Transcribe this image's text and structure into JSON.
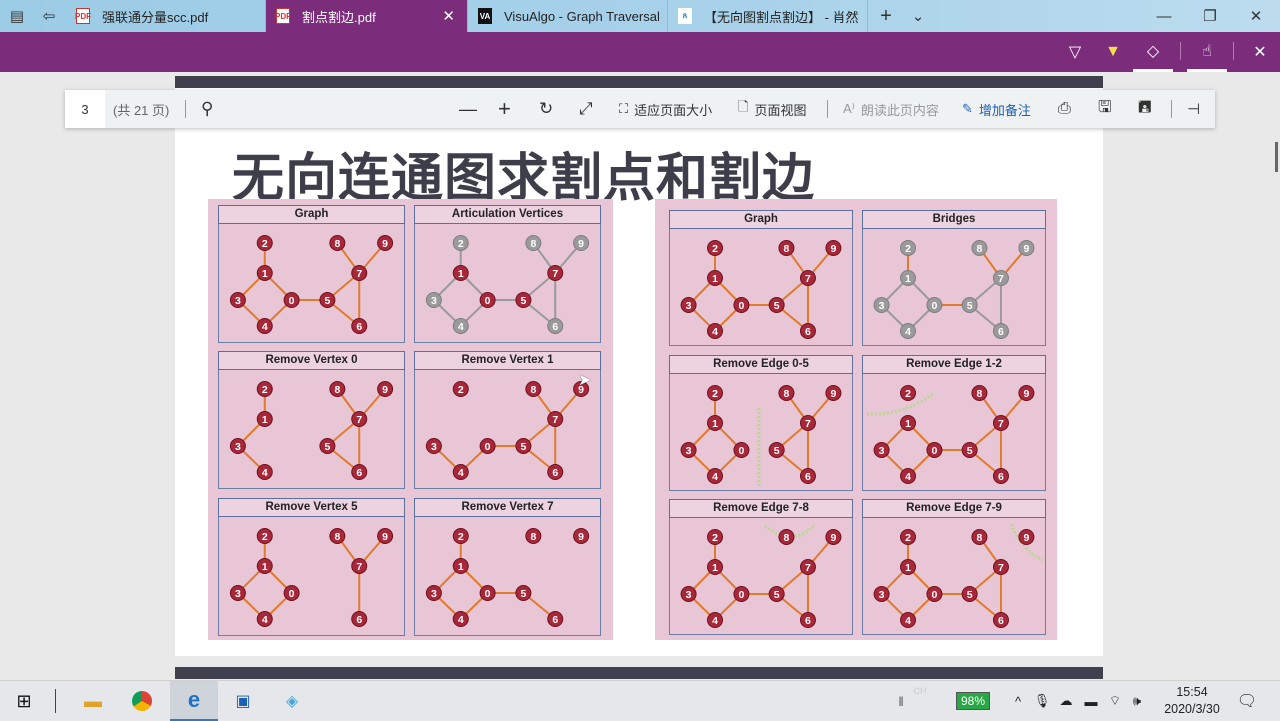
{
  "browser": {
    "tabs": [
      {
        "title": "强联通分量scc.pdf",
        "icon": "pdf-icon",
        "active": false
      },
      {
        "title": "割点割边.pdf",
        "icon": "pdf-icon",
        "active": true
      },
      {
        "title": "VisuAlgo - Graph Traversal (",
        "icon": "visualgo-icon",
        "active": false
      },
      {
        "title": "【无向图割点割边】 - 肖然",
        "icon": "site-icon",
        "active": false
      }
    ],
    "new_tab": "+",
    "tab_list": "⌄"
  },
  "pdf_toolbar": {
    "page_number": "3",
    "page_total": "(共 21 页)",
    "fit_page": "适应页面大小",
    "page_view": "页面视图",
    "read_aloud": "朗读此页内容",
    "add_notes": "增加备注"
  },
  "document": {
    "heading": "无向连通图求割点和割边",
    "left_panels": [
      {
        "title": "Graph",
        "gray_nodes": [],
        "gray_edges": []
      },
      {
        "title": "Articulation Vertices",
        "gray_nodes": [
          2,
          3,
          4,
          8,
          9,
          6
        ],
        "gray_edges": "all"
      },
      {
        "title": "Remove Vertex 0",
        "removed_node": 0
      },
      {
        "title": "Remove Vertex 1",
        "removed_node": 1
      },
      {
        "title": "Remove Vertex 5",
        "removed_node": 5
      },
      {
        "title": "Remove Vertex 7",
        "removed_node": 7
      }
    ],
    "right_panels": [
      {
        "title": "Graph"
      },
      {
        "title": "Bridges",
        "gray_nodes": "all",
        "bridge_edges": [
          "1-2",
          "0-5",
          "7-8",
          "7-9"
        ]
      },
      {
        "title": "Remove Edge 0-5",
        "removed_edge": "0-5"
      },
      {
        "title": "Remove Edge 1-2",
        "removed_edge": "1-2"
      },
      {
        "title": "Remove Edge 7-8",
        "removed_edge": "7-8"
      },
      {
        "title": "Remove Edge 7-9",
        "removed_edge": "7-9"
      }
    ],
    "graph_edges": [
      "1-2",
      "1-3",
      "1-0",
      "3-4",
      "4-0",
      "0-5",
      "5-7",
      "5-6",
      "7-6",
      "7-8",
      "7-9"
    ],
    "colors": {
      "node": "#a8283a",
      "edge": "#e07a2c",
      "gray": "#9a9a9a",
      "cut_line": "#b8d890",
      "panel_bg": "#e8c6d6"
    }
  },
  "taskbar": {
    "ime": "CH",
    "battery": "98%",
    "time": "15:54",
    "date": "2020/3/30"
  }
}
